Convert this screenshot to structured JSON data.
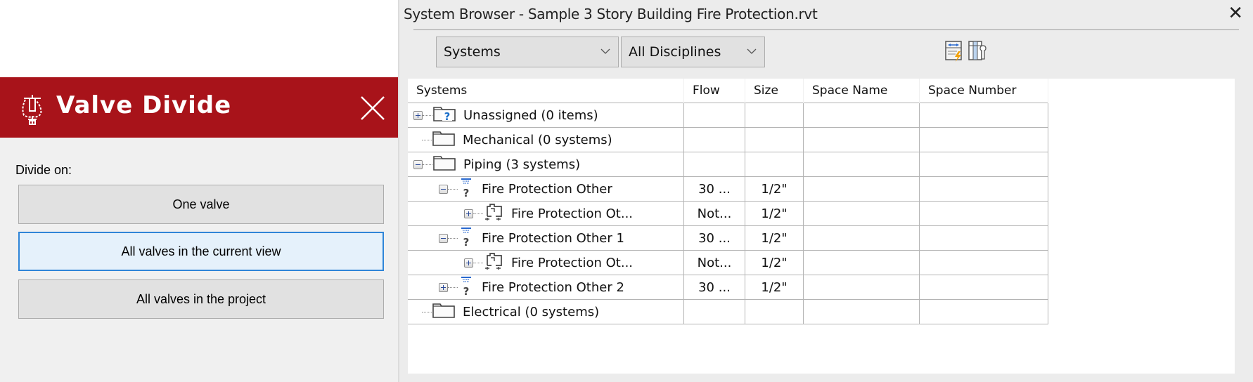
{
  "valve_divide": {
    "title": "Valve Divide",
    "label": "Divide on:",
    "buttons": [
      {
        "label": "One valve",
        "state": "normal"
      },
      {
        "label": "All valves in the current view",
        "state": "focused"
      },
      {
        "label": "All valves in the project",
        "state": "normal"
      }
    ],
    "colors": {
      "header": "#a8131a",
      "focus_border": "#2f85d8",
      "focus_fill": "#e5f1fb"
    }
  },
  "system_browser": {
    "title": "System Browser - Sample 3 Story Building Fire Protection.rvt",
    "close_label": "✕",
    "view_select": {
      "value": "Systems"
    },
    "discipline_select": {
      "value": "All Disciplines"
    },
    "toolbar": [
      "autofit-columns-icon",
      "column-settings-icon"
    ],
    "columns": [
      "Systems",
      "Flow",
      "Size",
      "Space Name",
      "Space Number"
    ],
    "rows": [
      {
        "name": "Unassigned (0 items)",
        "level": 0,
        "expander": "plus",
        "icon": "unassigned-folder-icon",
        "flow": "",
        "size": "",
        "space_name": "",
        "space_number": ""
      },
      {
        "name": "Mechanical (0 systems)",
        "level": 0,
        "expander": "none",
        "icon": "folder-icon",
        "flow": "",
        "size": "",
        "space_name": "",
        "space_number": ""
      },
      {
        "name": "Piping (3 systems)",
        "level": 0,
        "expander": "minus",
        "icon": "folder-icon",
        "flow": "",
        "size": "",
        "space_name": "",
        "space_number": ""
      },
      {
        "name": "Fire Protection Other",
        "level": 1,
        "expander": "minus",
        "icon": "sprinkler-system-icon",
        "flow": "30 ...",
        "size": "1/2\"",
        "space_name": "",
        "space_number": ""
      },
      {
        "name": "Fire Protection Ot...",
        "level": 2,
        "expander": "plus",
        "icon": "pipe-network-icon",
        "flow": "Not...",
        "size": "1/2\"",
        "space_name": "",
        "space_number": ""
      },
      {
        "name": "Fire Protection Other 1",
        "level": 1,
        "expander": "minus",
        "icon": "sprinkler-system-icon",
        "flow": "30 ...",
        "size": "1/2\"",
        "space_name": "",
        "space_number": ""
      },
      {
        "name": "Fire Protection Ot...",
        "level": 2,
        "expander": "plus",
        "icon": "pipe-network-icon",
        "flow": "Not...",
        "size": "1/2\"",
        "space_name": "",
        "space_number": ""
      },
      {
        "name": "Fire Protection Other 2",
        "level": 1,
        "expander": "plus",
        "icon": "sprinkler-system-icon",
        "flow": "30 ...",
        "size": "1/2\"",
        "space_name": "",
        "space_number": ""
      },
      {
        "name": "Electrical (0 systems)",
        "level": 0,
        "expander": "none",
        "icon": "folder-icon",
        "flow": "",
        "size": "",
        "space_name": "",
        "space_number": ""
      }
    ]
  }
}
